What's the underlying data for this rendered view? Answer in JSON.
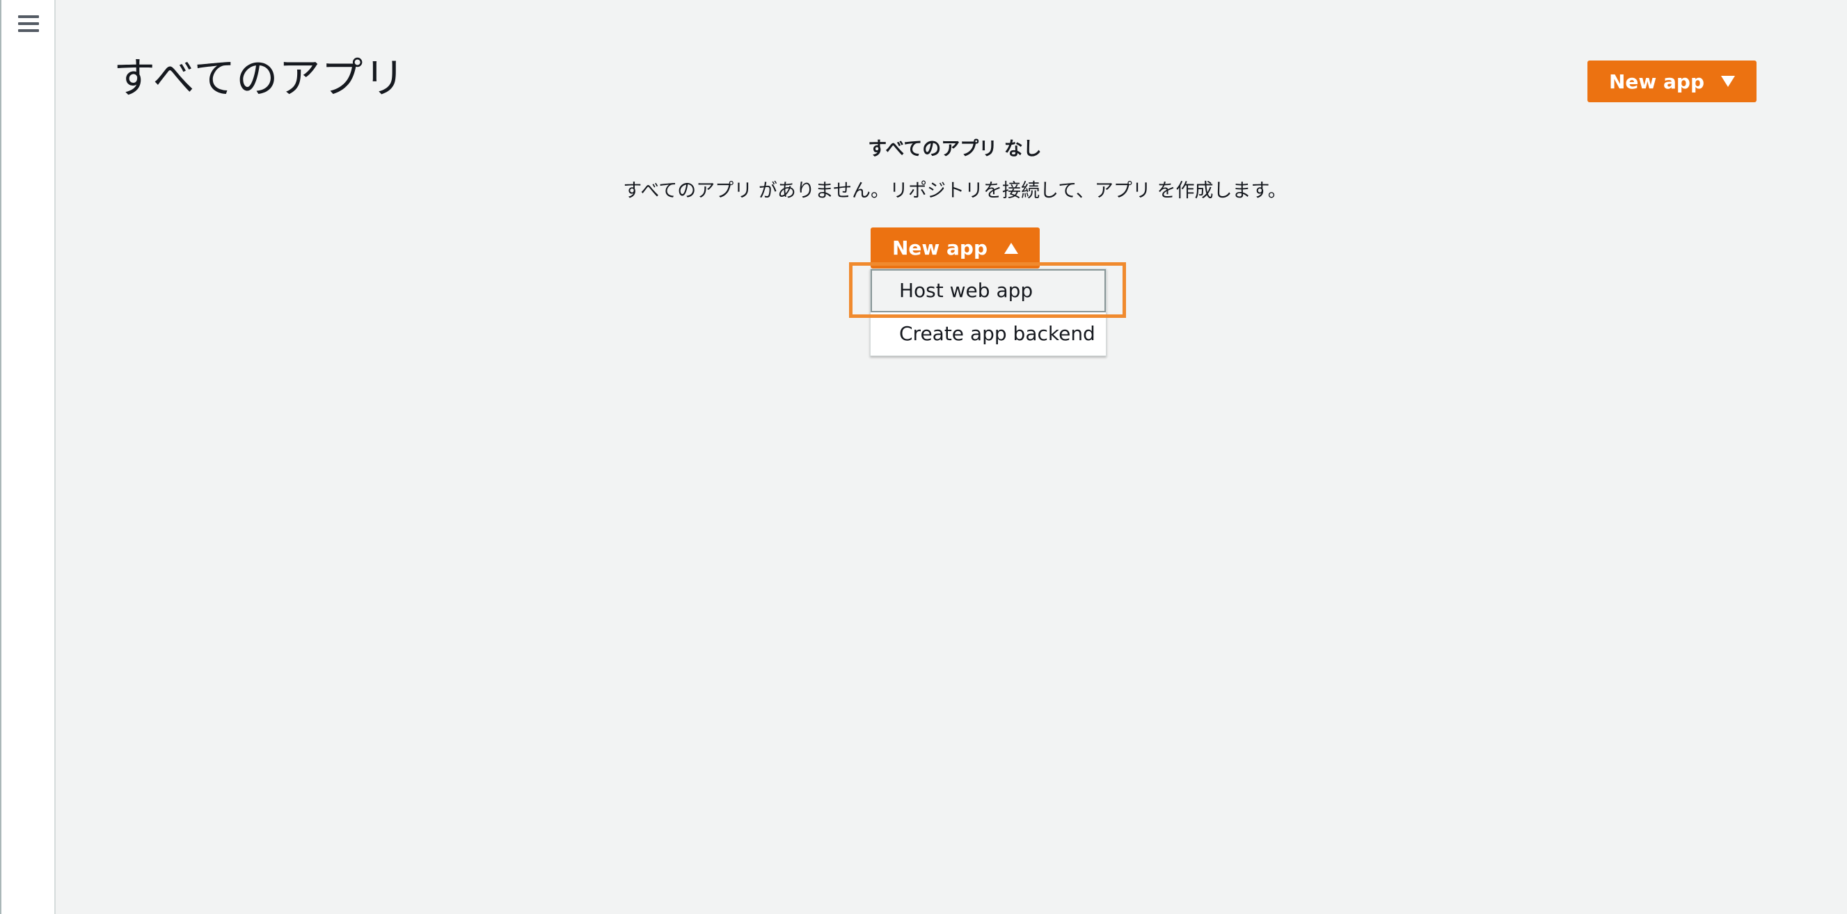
{
  "header": {
    "title": "すべてのアプリ",
    "new_app_label": "New app"
  },
  "empty_state": {
    "title": "すべてのアプリ なし",
    "description": "すべてのアプリ がありません。リポジトリを接続して、アプリ を作成します。",
    "new_app_label": "New app"
  },
  "dropdown": {
    "items": [
      {
        "label": "Host web app"
      },
      {
        "label": "Create app backend"
      }
    ]
  },
  "colors": {
    "accent": "#ec7211",
    "background": "#f2f3f3",
    "highlight": "#f08a2e"
  },
  "icons": {
    "menu": "hamburger-menu-icon",
    "caret_down": "caret-down-icon",
    "caret_up": "caret-up-icon"
  }
}
